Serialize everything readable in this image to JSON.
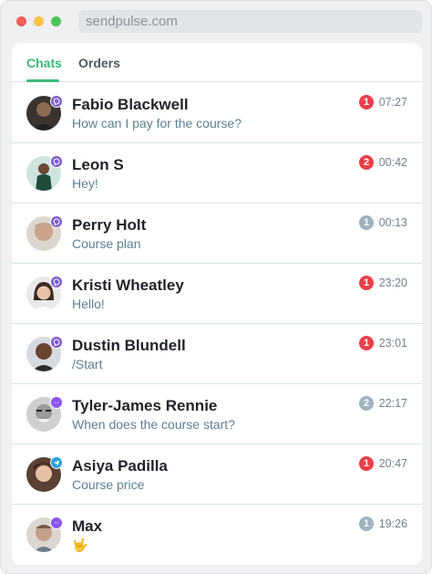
{
  "window": {
    "url": "sendpulse.com"
  },
  "tabs": [
    {
      "label": "Chats",
      "active": true
    },
    {
      "label": "Orders",
      "active": false
    }
  ],
  "colors": {
    "accent": "#3eb87d",
    "unread_red": "#e8404a",
    "unread_grey": "#9fb3bf",
    "viber": "#7d5ccb",
    "telegram": "#2aa2de",
    "messenger": "#8a56f0"
  },
  "chats": [
    {
      "name": "Fabio Blackwell",
      "message": "How can I pay for the course?",
      "count": "1",
      "count_color": "red",
      "time": "07:27",
      "channel": "viber-icon"
    },
    {
      "name": "Leon S",
      "message": "Hey!",
      "count": "2",
      "count_color": "red",
      "time": "00:42",
      "channel": "viber-icon"
    },
    {
      "name": "Perry Holt",
      "message": "Course plan",
      "count": "1",
      "count_color": "grey",
      "time": "00:13",
      "channel": "viber-icon"
    },
    {
      "name": "Kristi Wheatley",
      "message": "Hello!",
      "count": "1",
      "count_color": "red",
      "time": "23:20",
      "channel": "viber-icon"
    },
    {
      "name": "Dustin Blundell",
      "message": "/Start",
      "count": "1",
      "count_color": "red",
      "time": "23:01",
      "channel": "viber-icon"
    },
    {
      "name": "Tyler-James Rennie",
      "message": "When does the course start?",
      "count": "2",
      "count_color": "grey",
      "time": "22:17",
      "channel": "messenger-icon"
    },
    {
      "name": "Asiya Padilla",
      "message": "Course price",
      "count": "1",
      "count_color": "red",
      "time": "20:47",
      "channel": "telegram-icon"
    },
    {
      "name": "Max",
      "message": "🤟",
      "count": "1",
      "count_color": "grey",
      "time": "19:26",
      "channel": "messenger-icon"
    }
  ]
}
